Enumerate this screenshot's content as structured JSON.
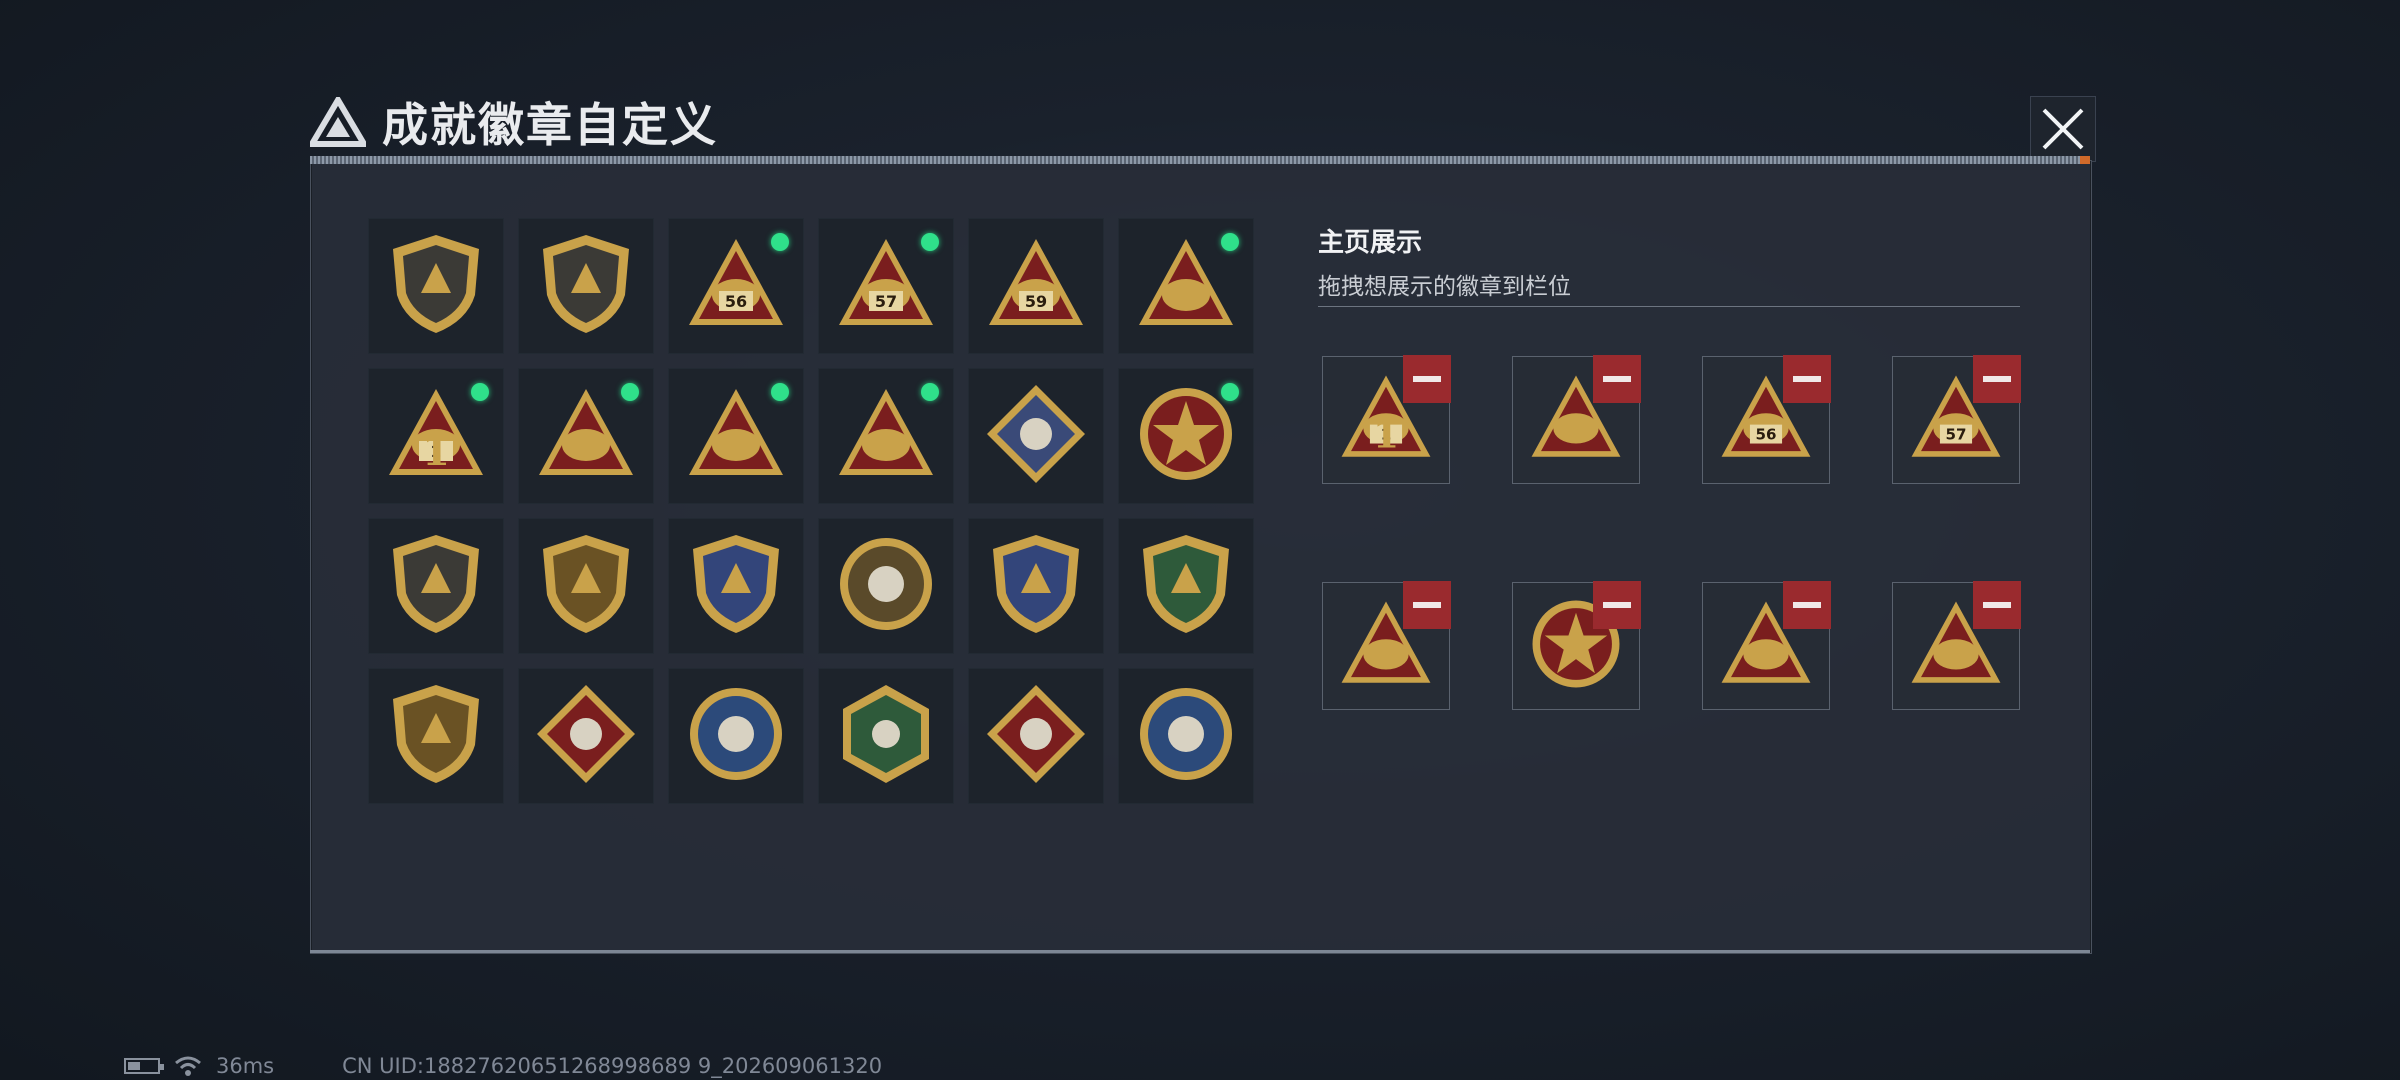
{
  "title": "成就徽章自定义",
  "showcase": {
    "title": "主页展示",
    "subtitle": "拖拽想展示的徽章到栏位"
  },
  "colors": {
    "accent_green": "#2fe08a",
    "remove_red": "#9a2a2e",
    "gold": "#c9a24a"
  },
  "badges": [
    {
      "icon": "shield-peak-icon",
      "selected": false
    },
    {
      "icon": "helicopter-shield-icon",
      "selected": false
    },
    {
      "icon": "triangle-56-icon",
      "selected": true,
      "label": "56"
    },
    {
      "icon": "triangle-57-icon",
      "selected": true,
      "label": "57"
    },
    {
      "icon": "triangle-59-icon",
      "selected": false,
      "label": "59"
    },
    {
      "icon": "triangle-wing-icon",
      "selected": true
    },
    {
      "icon": "triangle-1-icon",
      "selected": true,
      "label": "1"
    },
    {
      "icon": "triangle-hands-icon",
      "selected": true
    },
    {
      "icon": "triangle-soldiers-icon",
      "selected": true
    },
    {
      "icon": "triangle-rocket-icon",
      "selected": true
    },
    {
      "icon": "diamond-rose-icon",
      "selected": false
    },
    {
      "icon": "star-medallion-icon",
      "selected": true
    },
    {
      "icon": "shield-chevron-icon",
      "selected": false
    },
    {
      "icon": "laurel-shield-icon",
      "selected": false
    },
    {
      "icon": "blue-gem-shield-icon",
      "selected": false
    },
    {
      "icon": "round-skull-icon",
      "selected": false
    },
    {
      "icon": "blue-rifle-shield-icon",
      "selected": false
    },
    {
      "icon": "green-rifle-shield-icon",
      "selected": false
    },
    {
      "icon": "gold-crosshair-shield-icon",
      "selected": false
    },
    {
      "icon": "wolf-diamond-icon",
      "selected": false
    },
    {
      "icon": "eagle-circle-icon",
      "selected": false
    },
    {
      "icon": "wasp-hexagon-icon",
      "selected": false
    },
    {
      "icon": "dragon-diamond-icon",
      "selected": false
    },
    {
      "icon": "wolf-circle-icon",
      "selected": false
    }
  ],
  "slots": [
    {
      "icon": "triangle-1-icon",
      "label": "1"
    },
    {
      "icon": "triangle-wing-icon"
    },
    {
      "icon": "triangle-56-icon",
      "label": "56"
    },
    {
      "icon": "triangle-57-icon",
      "label": "57"
    },
    {
      "icon": "triangle-rocket-icon"
    },
    {
      "icon": "star-medallion-icon"
    },
    {
      "icon": "triangle-soldiers-icon"
    },
    {
      "icon": "triangle-hands-icon"
    }
  ],
  "status": {
    "ping": "36ms",
    "uid": "CN UID:18827620651268998689 9_202609061320"
  }
}
